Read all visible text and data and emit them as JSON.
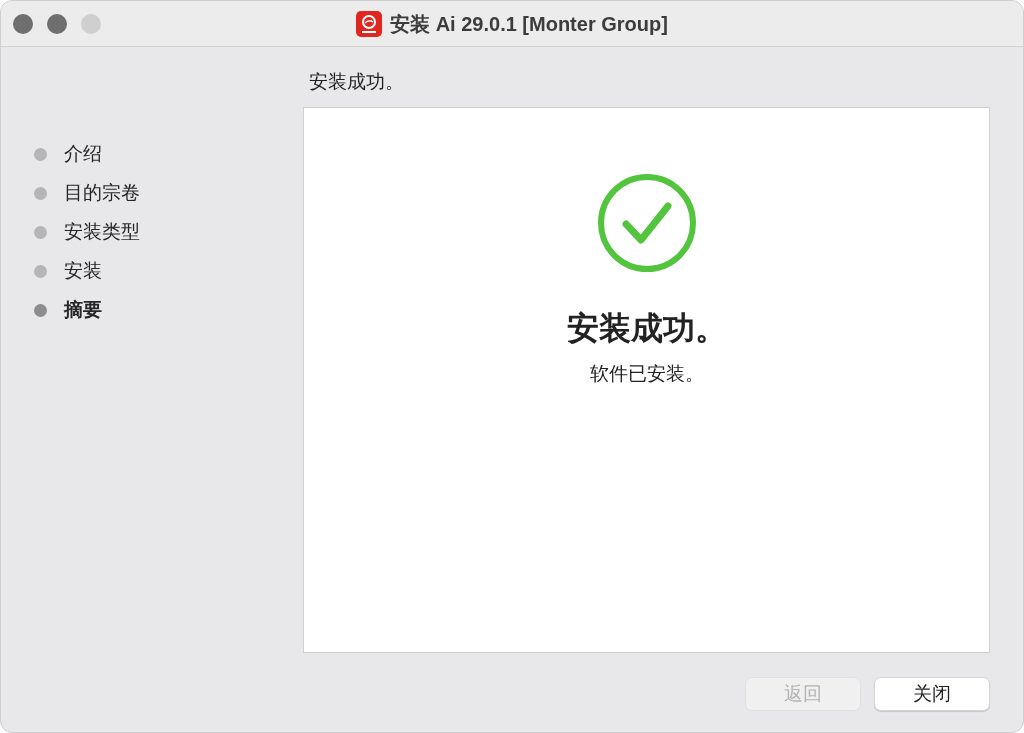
{
  "window": {
    "title": "安装 Ai 29.0.1 [Monter Group]"
  },
  "sidebar": {
    "items": [
      {
        "label": "介绍",
        "selected": false
      },
      {
        "label": "目的宗卷",
        "selected": false
      },
      {
        "label": "安装类型",
        "selected": false
      },
      {
        "label": "安装",
        "selected": false
      },
      {
        "label": "摘要",
        "selected": true
      }
    ]
  },
  "content": {
    "heading": "安装成功。",
    "title": "安装成功。",
    "message": "软件已安装。"
  },
  "buttons": [
    {
      "label": "返回",
      "disabled": true
    },
    {
      "label": "关闭",
      "disabled": false
    }
  ]
}
